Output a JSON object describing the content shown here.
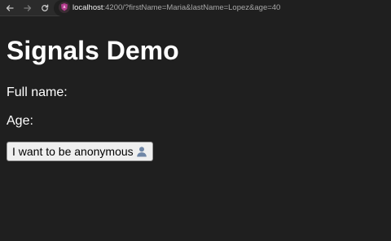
{
  "browser": {
    "url_host": "localhost",
    "url_rest": ":4200/?firstName=Maria&lastName=Lopez&age=40",
    "icons": {
      "back": "arrow-left",
      "forward": "arrow-right",
      "reload": "reload",
      "site": "angular-favicon"
    }
  },
  "page": {
    "title": "Signals Demo",
    "full_name_label": "Full name:",
    "age_label": "Age:",
    "anonymous_button_label": "I want to be anonymous",
    "anonymous_button_icon": "bust-in-silhouette"
  },
  "colors": {
    "page_background": "#1f1f1f",
    "toolbar_background": "#2b2b2b",
    "text": "#ffffff",
    "button_background": "#efefef"
  }
}
